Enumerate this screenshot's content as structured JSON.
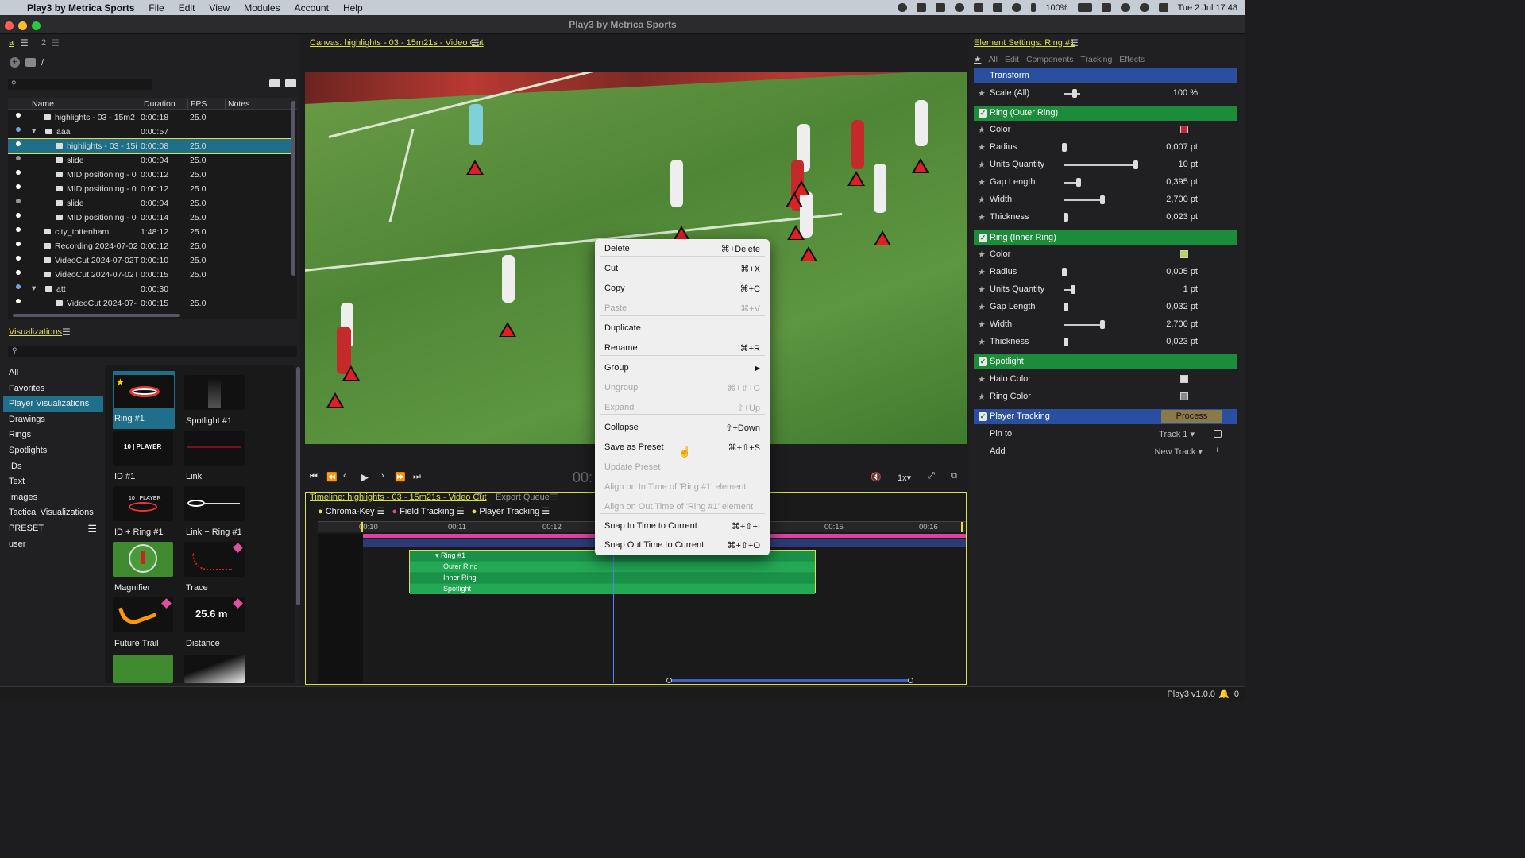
{
  "menubar": {
    "app": "Play3 by Metrica Sports",
    "items": [
      "File",
      "Edit",
      "View",
      "Modules",
      "Account",
      "Help"
    ],
    "battery": "100%",
    "clock": "Tue 2 Jul  17:48"
  },
  "window": {
    "title": "Play3 by Metrica Sports"
  },
  "left": {
    "tab_a": "a",
    "tab_2": "2",
    "path": "/",
    "columns": [
      "Name",
      "Duration",
      "FPS",
      "Notes"
    ],
    "rows": [
      {
        "name": "highlights - 03 - 15m2",
        "duration": "0:00:18",
        "fps": "25.0",
        "indent": 1,
        "type": "video",
        "dot": "white"
      },
      {
        "name": "aaa",
        "duration": "0:00:57",
        "fps": "",
        "indent": 1,
        "type": "folder",
        "dot": "blue"
      },
      {
        "name": "highlights - 03 - 15i",
        "duration": "0:00:08",
        "fps": "25.0",
        "indent": 2,
        "type": "video",
        "dot": "white",
        "selected": true
      },
      {
        "name": "slide",
        "duration": "0:00:04",
        "fps": "25.0",
        "indent": 2,
        "type": "video",
        "dot": "grey"
      },
      {
        "name": "MID positioning - 0",
        "duration": "0:00:12",
        "fps": "25.0",
        "indent": 2,
        "type": "video",
        "dot": "white"
      },
      {
        "name": "MID positioning - 0",
        "duration": "0:00:12",
        "fps": "25.0",
        "indent": 2,
        "type": "video",
        "dot": "white"
      },
      {
        "name": "slide",
        "duration": "0:00:04",
        "fps": "25.0",
        "indent": 2,
        "type": "video",
        "dot": "grey"
      },
      {
        "name": "MID positioning - 0",
        "duration": "0:00:14",
        "fps": "25.0",
        "indent": 2,
        "type": "video",
        "dot": "white"
      },
      {
        "name": "city_tottenham",
        "duration": "1:48:12",
        "fps": "25.0",
        "indent": 1,
        "type": "video",
        "dot": "white"
      },
      {
        "name": "Recording 2024-07-02",
        "duration": "0:00:12",
        "fps": "25.0",
        "indent": 1,
        "type": "video",
        "dot": "white"
      },
      {
        "name": "VideoCut 2024-07-02T",
        "duration": "0:00:10",
        "fps": "25.0",
        "indent": 1,
        "type": "video",
        "dot": "white"
      },
      {
        "name": "VideoCut 2024-07-02T",
        "duration": "0:00:15",
        "fps": "25.0",
        "indent": 1,
        "type": "video",
        "dot": "white"
      },
      {
        "name": "att",
        "duration": "0:00:30",
        "fps": "",
        "indent": 1,
        "type": "folder",
        "dot": "blue"
      },
      {
        "name": "VideoCut 2024-07-",
        "duration": "0:00:15",
        "fps": "25.0",
        "indent": 2,
        "type": "video",
        "dot": "white"
      }
    ],
    "visualizations_title": "Visualizations",
    "categories": [
      "All",
      "Favorites",
      "Player Visualizations",
      "Drawings",
      "Rings",
      "Spotlights",
      "IDs",
      "Text",
      "Images",
      "Tactical Visualizations",
      "PRESET",
      "user"
    ],
    "viz_items": [
      "Ring #1",
      "Spotlight #1",
      "ID #1",
      "Link",
      "ID + Ring #1",
      "Link + Ring #1",
      "Magnifier",
      "Trace",
      "Future Trail",
      "Distance"
    ],
    "id_thumb_text": "10 | PLAYER",
    "distance_thumb_text": "25.6 m"
  },
  "canvas": {
    "title": "Canvas: highlights - 03 - 15m21s - Video Cut",
    "speed": "1x",
    "time_partial": "00:"
  },
  "timeline": {
    "title": "Timeline: highlights - 03 - 15m21s - Video Cut",
    "export": "Export Queue",
    "modules": [
      "Chroma-Key",
      "Field Tracking",
      "Player Tracking"
    ],
    "ticks": [
      "00:10",
      "00:11",
      "00:12",
      "00:15",
      "00:16"
    ],
    "tracks": [
      "Ring #1",
      "Outer Ring",
      "Inner Ring",
      "Spotlight"
    ]
  },
  "context_menu": [
    {
      "label": "Delete",
      "shortcut": "⌘+Delete",
      "enabled": true
    },
    {
      "label": "Cut",
      "shortcut": "⌘+X",
      "enabled": true
    },
    {
      "label": "Copy",
      "shortcut": "⌘+C",
      "enabled": true
    },
    {
      "label": "Paste",
      "shortcut": "⌘+V",
      "enabled": false
    },
    {
      "label": "Duplicate",
      "shortcut": "",
      "enabled": true
    },
    {
      "label": "Rename",
      "shortcut": "⌘+R",
      "enabled": true
    },
    {
      "label": "Group",
      "shortcut": "▶",
      "enabled": true
    },
    {
      "label": "Ungroup",
      "shortcut": "⌘+⇧+G",
      "enabled": false
    },
    {
      "label": "Expand",
      "shortcut": "⇧+Up",
      "enabled": false
    },
    {
      "label": "Collapse",
      "shortcut": "⇧+Down",
      "enabled": true
    },
    {
      "label": "Save as Preset",
      "shortcut": "⌘+⇧+S",
      "enabled": true
    },
    {
      "label": "Update Preset",
      "shortcut": "",
      "enabled": false
    },
    {
      "label": "Align on In Time of 'Ring #1' element",
      "shortcut": "",
      "enabled": false
    },
    {
      "label": "Align on Out Time of 'Ring #1' element",
      "shortcut": "",
      "enabled": false
    },
    {
      "label": "Snap In Time to Current",
      "shortcut": "⌘+⇧+I",
      "enabled": true
    },
    {
      "label": "Snap Out Time to Current",
      "shortcut": "⌘+⇧+O",
      "enabled": true
    }
  ],
  "element_settings": {
    "title": "Element Settings: Ring #1",
    "tabs": [
      "All",
      "Edit",
      "Components",
      "Tracking",
      "Effects"
    ],
    "transform": "Transform",
    "scale": {
      "label": "Scale (All)",
      "value": "100 %",
      "level": 0.05
    },
    "outer": {
      "title": "Ring (Outer Ring)",
      "color_label": "Color",
      "color": "#c0283a",
      "rows": [
        {
          "label": "Radius",
          "value": "0,007 pt",
          "level": 0.0
        },
        {
          "label": "Units Quantity",
          "value": "10 pt",
          "level": 0.98
        },
        {
          "label": "Gap Length",
          "value": "0,395 pt",
          "level": 0.2
        },
        {
          "label": "Width",
          "value": "2,700 pt",
          "level": 0.52
        },
        {
          "label": "Thickness",
          "value": "0,023 pt",
          "level": 0.02
        }
      ]
    },
    "inner": {
      "title": "Ring (Inner Ring)",
      "color_label": "Color",
      "color": "#b8d84a",
      "rows": [
        {
          "label": "Radius",
          "value": "0,005 pt",
          "level": 0.0
        },
        {
          "label": "Units Quantity",
          "value": "1 pt",
          "level": 0.12
        },
        {
          "label": "Gap Length",
          "value": "0,032 pt",
          "level": 0.02
        },
        {
          "label": "Width",
          "value": "2,700 pt",
          "level": 0.52
        },
        {
          "label": "Thickness",
          "value": "0,023 pt",
          "level": 0.02
        }
      ]
    },
    "spotlight": {
      "title": "Spotlight",
      "halo": "Halo Color",
      "ring": "Ring Color"
    },
    "tracking": {
      "title": "Player Tracking",
      "process": "Process",
      "pin_label": "Pin to",
      "pin_value": "Track 1",
      "add_label": "Add",
      "add_value": "New Track"
    }
  },
  "status": {
    "version": "Play3 v1.0.0",
    "notifications": "0"
  }
}
